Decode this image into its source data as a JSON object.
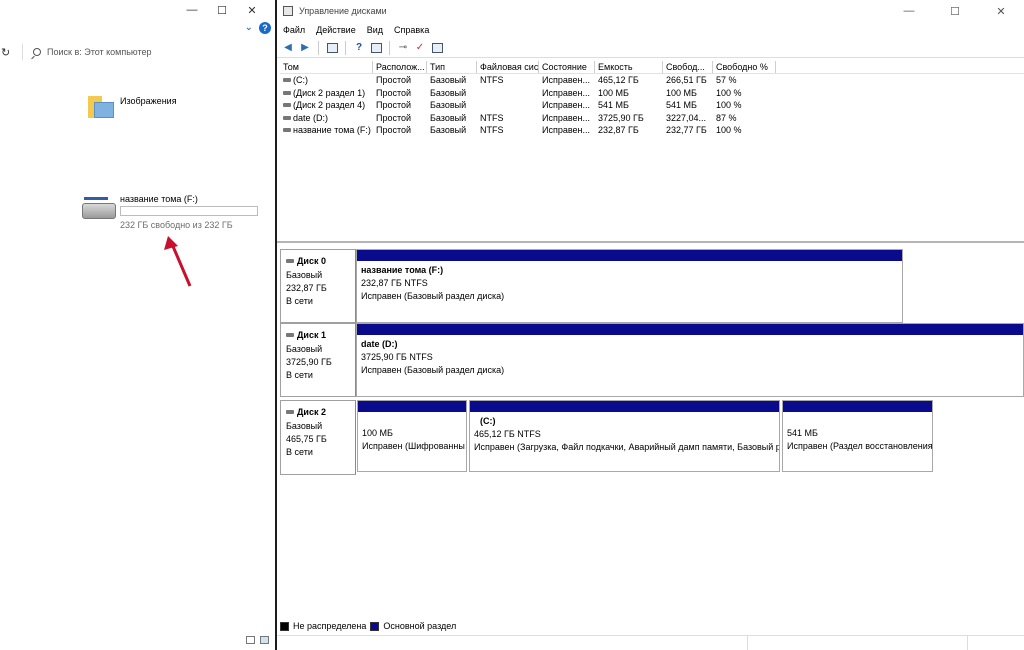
{
  "explorer": {
    "window_buttons": [
      "—",
      "☐",
      "✕"
    ],
    "refresh_glyph": "↻",
    "help_glyph": "?",
    "search_placeholder": "Поиск в: Этот компьютер",
    "folder": {
      "label": "Изображения",
      "icon": "pictures-folder-icon"
    },
    "drive": {
      "name": "название тома (F:)",
      "free_text": "232 ГБ свободно из 232 ГБ",
      "used_fraction": 0.0,
      "icon": "hard-drive-icon"
    },
    "annotation_arrow_color": "#c8102e"
  },
  "diskmgmt": {
    "title": "Управление дисками",
    "window_buttons": [
      "—",
      "☐",
      "✕"
    ],
    "menu": [
      "Файл",
      "Действие",
      "Вид",
      "Справка"
    ],
    "volume_table": {
      "columns": [
        "Том",
        "Располож...",
        "Тип",
        "Файловая систе...",
        "Состояние",
        "Емкость",
        "Свобод...",
        "Свободно %"
      ],
      "rows": [
        [
          "(C:)",
          "Простой",
          "Базовый",
          "NTFS",
          "Исправен...",
          "465,12 ГБ",
          "266,51 ГБ",
          "57 %"
        ],
        [
          "(Диск 2 раздел 1)",
          "Простой",
          "Базовый",
          "",
          "Исправен...",
          "100 МБ",
          "100 МБ",
          "100 %"
        ],
        [
          "(Диск 2 раздел 4)",
          "Простой",
          "Базовый",
          "",
          "Исправен...",
          "541 МБ",
          "541 МБ",
          "100 %"
        ],
        [
          "date (D:)",
          "Простой",
          "Базовый",
          "NTFS",
          "Исправен...",
          "3725,90 ГБ",
          "3227,04...",
          "87 %"
        ],
        [
          "название тома (F:)",
          "Простой",
          "Базовый",
          "NTFS",
          "Исправен...",
          "232,87 ГБ",
          "232,77 ГБ",
          "100 %"
        ]
      ]
    },
    "disks": [
      {
        "name": "Диск 0",
        "type": "Базовый",
        "size": "232,87 ГБ",
        "status": "В сети",
        "partitions": [
          {
            "title": "название тома  (F:)",
            "size": "232,87 ГБ NTFS",
            "state": "Исправен (Базовый раздел диска)"
          }
        ]
      },
      {
        "name": "Диск 1",
        "type": "Базовый",
        "size": "3725,90 ГБ",
        "status": "В сети",
        "partitions": [
          {
            "title": "date  (D:)",
            "size": "3725,90 ГБ NTFS",
            "state": "Исправен (Базовый раздел диска)"
          }
        ]
      },
      {
        "name": "Диск 2",
        "type": "Базовый",
        "size": "465,75 ГБ",
        "status": "В сети",
        "partitions": [
          {
            "title": "",
            "size": "100 МБ",
            "state": "Исправен (Шифрованны"
          },
          {
            "title": "(C:)",
            "size": "465,12 ГБ NTFS",
            "state": "Исправен (Загрузка, Файл подкачки, Аварийный дамп памяти, Базовый ра:"
          },
          {
            "title": "",
            "size": "541 МБ",
            "state": "Исправен (Раздел восстановления)"
          }
        ]
      }
    ],
    "legend": [
      {
        "label": "Не распределена",
        "color": "#000000"
      },
      {
        "label": "Основной раздел",
        "color": "#0a0a8c"
      }
    ]
  }
}
